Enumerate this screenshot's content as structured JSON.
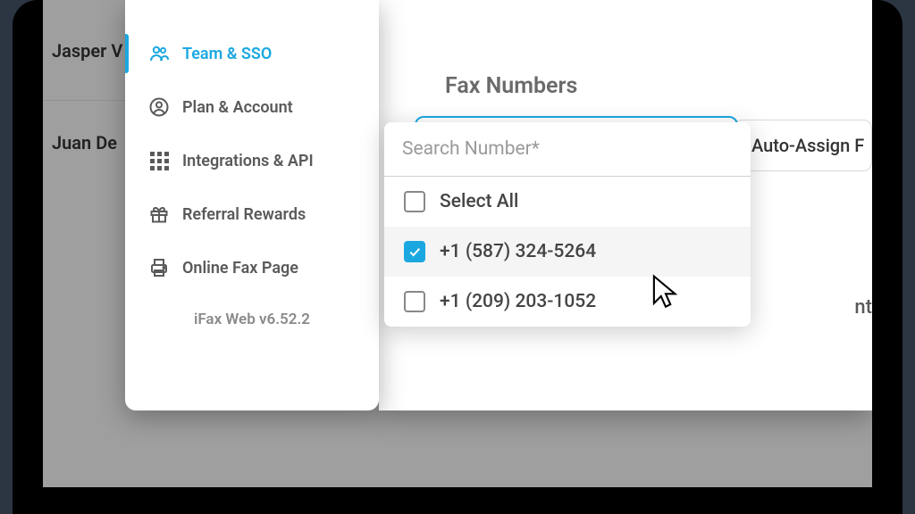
{
  "bg_rows": {
    "row1": "Jasper V",
    "row2": "Juan De"
  },
  "sidebar": {
    "items": [
      {
        "label": "Team & SSO"
      },
      {
        "label": "Plan & Account"
      },
      {
        "label": "Integrations & API"
      },
      {
        "label": "Referral Rewards"
      },
      {
        "label": "Online Fax Page"
      }
    ],
    "version": "iFax Web v6.52.2"
  },
  "main": {
    "section_title": "Fax Numbers",
    "auto_assign_label": "Auto-Assign F",
    "behind_text": "nt",
    "search_placeholder": "Search Number*",
    "select_all_label": "Select All",
    "options": [
      {
        "label": "+1 (587) 324-5264",
        "checked": true
      },
      {
        "label": "+1 (209) 203-1052",
        "checked": false
      }
    ]
  },
  "colors": {
    "accent": "#1ba8e0"
  }
}
